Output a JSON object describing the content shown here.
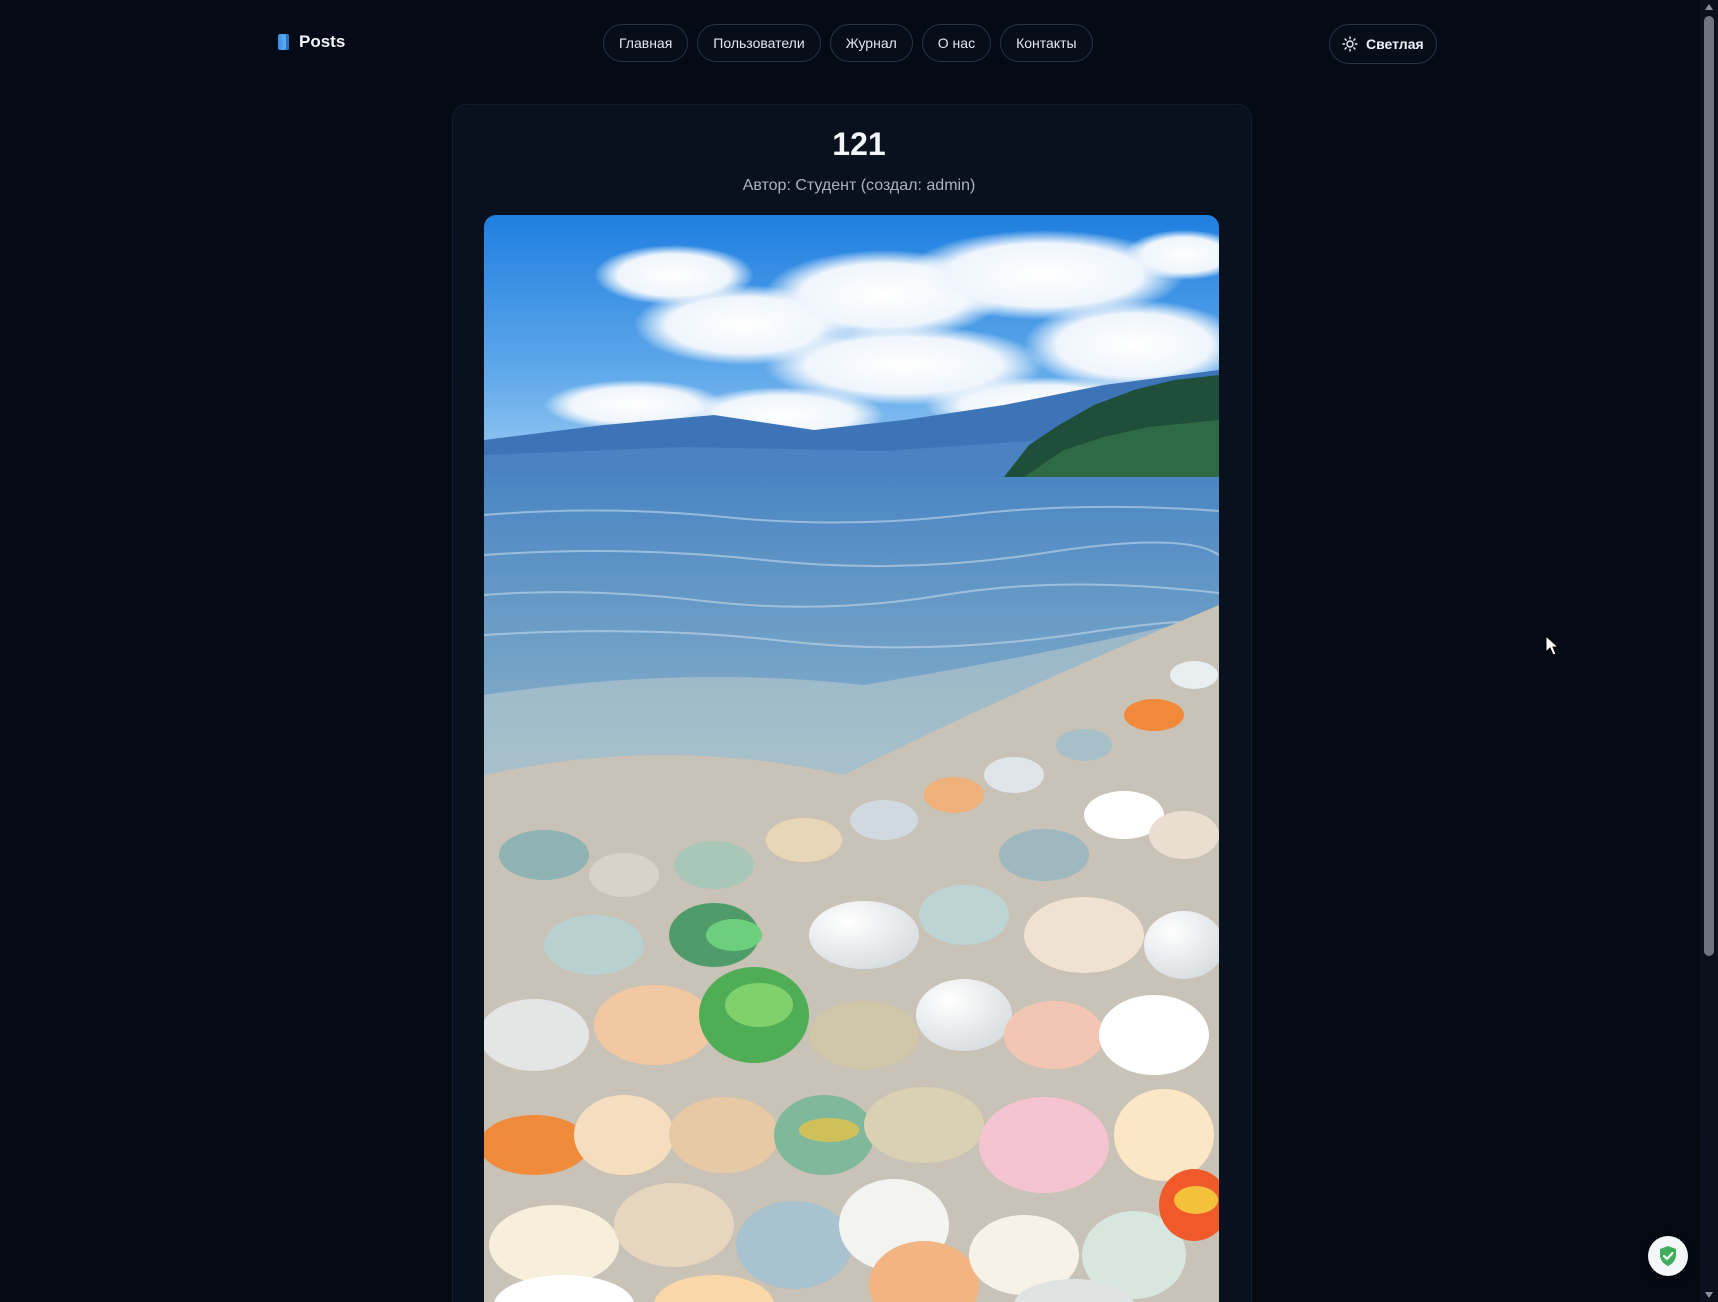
{
  "brand": {
    "label": "Posts",
    "icon": "book-icon",
    "accent": "#4a9fe8"
  },
  "nav": {
    "items": [
      {
        "label": "Главная"
      },
      {
        "label": "Пользователи"
      },
      {
        "label": "Журнал"
      },
      {
        "label": "О нас"
      },
      {
        "label": "Контакты"
      }
    ]
  },
  "theme_toggle": {
    "label": "Светлая",
    "icon": "sun-icon"
  },
  "post": {
    "title": "121",
    "meta": "Автор: Студент (создал: admin)",
    "image_subject": "pebble-beach-photo"
  },
  "colors": {
    "background": "#050a14",
    "card": "#0a111e",
    "border": "#2a3344",
    "shield": "#3fae5a"
  }
}
